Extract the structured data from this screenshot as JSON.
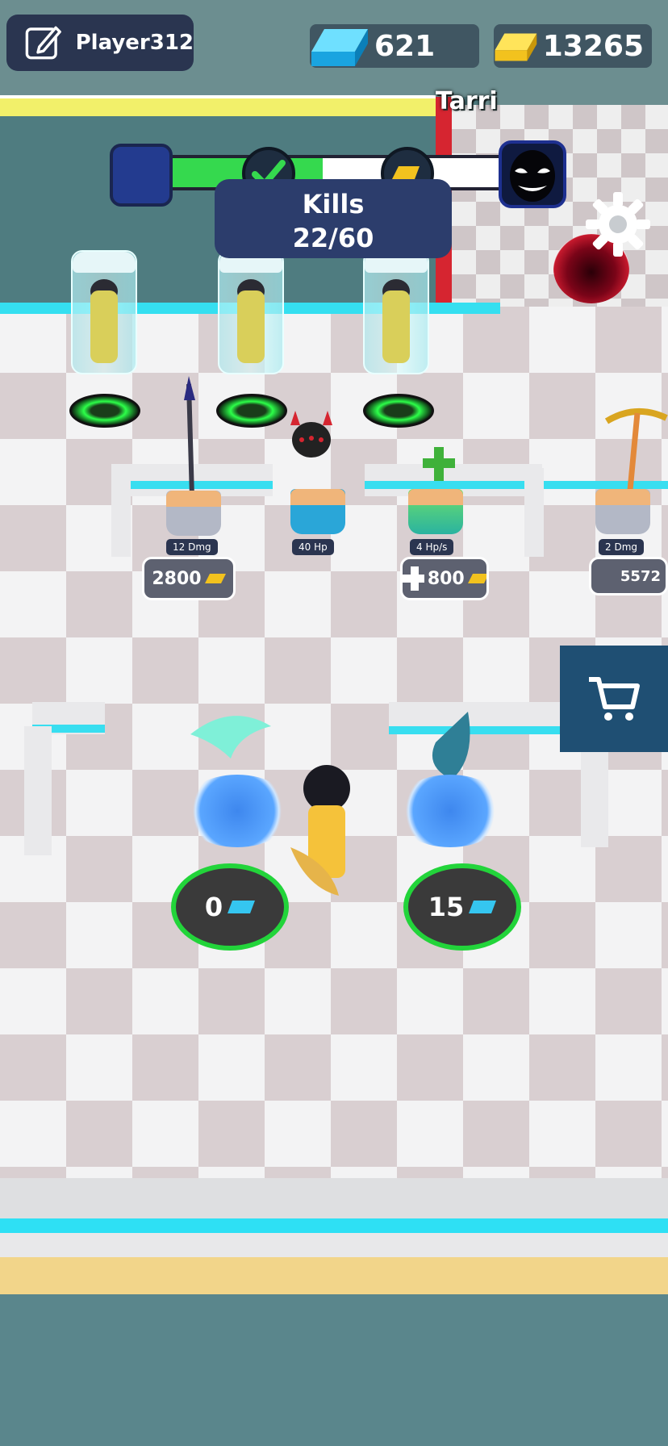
{
  "player": {
    "name": "Player312"
  },
  "currency": {
    "blue_gems": "621",
    "gold_bars": "13265"
  },
  "enemy_label": "Tarri",
  "kills": {
    "title": "Kills",
    "count": "22/60",
    "progress": 0.44
  },
  "shop": [
    {
      "stat": "12 Dmg",
      "price": "2800",
      "item": "spear"
    },
    {
      "stat": "40 Hp",
      "price": "",
      "item": "helmet"
    },
    {
      "stat": "4 Hp/s",
      "price": "800",
      "item": "health-plus"
    },
    {
      "stat": "2 Dmg",
      "price": "5572",
      "item": "pickaxe"
    }
  ],
  "upgrades": [
    {
      "cost": "0",
      "icon": "tornado-icon"
    },
    {
      "cost": "15",
      "icon": "drop-icon"
    }
  ],
  "colors": {
    "accent_green": "#22d43a",
    "gem_blue": "#35c6f0",
    "gold": "#f2c21e",
    "hud_navy": "#2a3550"
  }
}
